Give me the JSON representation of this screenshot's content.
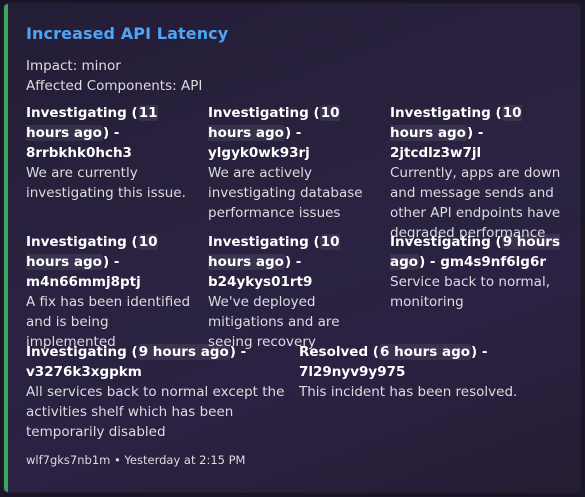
{
  "embed": {
    "accent_color": "#3ba55c",
    "title": "Increased API Latency",
    "impact": "Impact: minor",
    "components": "Affected Components: API"
  },
  "updates": [
    {
      "status": "Investigating",
      "time": "11 hours ago",
      "id": "8rrbkhk0hch3",
      "message": "We are currently investigating this issue."
    },
    {
      "status": "Investigating",
      "time": "10 hours ago",
      "id": "ylgyk0wk93rj",
      "message": "We are actively investigating database performance issues"
    },
    {
      "status": "Investigating",
      "time": "10 hours ago",
      "id": "2jtcdlz3w7jl",
      "message": "Currently, apps are down and message sends and other API endpoints have degraded performance"
    },
    {
      "status": "Investigating",
      "time": "10 hours ago",
      "id": "m4n66mmj8ptj",
      "message": "A fix has been identified and is being implemented"
    },
    {
      "status": "Investigating",
      "time": "10 hours ago",
      "id": "b24ykys01rt9",
      "message": "We've deployed mitigations and are seeing recovery"
    },
    {
      "status": "Investigating",
      "time": "9 hours ago",
      "id": "gm4s9nf6lg6r",
      "message": "Service back to normal, monitoring"
    },
    {
      "status": "Investigating",
      "time": "9 hours ago",
      "id": "v3276k3xgpkm",
      "message": "All services back to normal except the activities shelf which has been temporarily disabled"
    },
    {
      "status": "Resolved",
      "time": "6 hours ago",
      "id": "7l29nyv9y975",
      "message": "This incident has been resolved."
    }
  ],
  "footer": {
    "text": "wlf7gks7nb1m • Yesterday at 2:15 PM"
  }
}
